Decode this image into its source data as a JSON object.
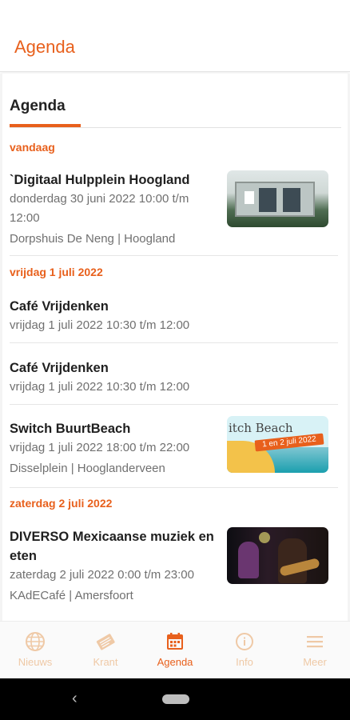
{
  "app": {
    "title": "Agenda"
  },
  "tabs": {
    "active": "Agenda"
  },
  "days": [
    {
      "label": "vandaag",
      "events": [
        {
          "title": "`Digitaal Hulpplein Hoogland",
          "lines": [
            "donderdag 30 juni 2022 10:00 t/m",
            "12:00"
          ],
          "place": "Dorpshuis De Neng | Hoogland",
          "image": "building-photo"
        }
      ]
    },
    {
      "label": "vrijdag 1 juli 2022",
      "events": [
        {
          "title": "Café Vrijdenken",
          "lines": [
            "vrijdag 1 juli 2022 10:30 t/m 12:00"
          ]
        },
        {
          "title": "Café Vrijdenken",
          "lines": [
            "vrijdag 1 juli 2022 10:30 t/m 12:00"
          ]
        },
        {
          "title": "Switch BuurtBeach",
          "lines": [
            "vrijdag 1 juli 2022 18:00 t/m 22:00"
          ],
          "place": "Disselplein | Hooglanderveen",
          "image": "beach-poster",
          "image_text": "itch Beach",
          "image_banner": "1 en 2 juli 2022"
        }
      ]
    },
    {
      "label": "zaterdag 2 juli 2022",
      "events": [
        {
          "title_line1": "DIVERSO Mexicaanse muziek en",
          "title_line2": "eten",
          "lines": [
            "zaterdag 2 juli 2022 0:00 t/m 23:00"
          ],
          "place": "KAdECafé | Amersfoort",
          "image": "musicians-photo"
        }
      ]
    }
  ],
  "bottom_nav": [
    {
      "label": "Nieuws",
      "icon": "globe-icon",
      "active": false
    },
    {
      "label": "Krant",
      "icon": "newspaper-icon",
      "active": false
    },
    {
      "label": "Agenda",
      "icon": "calendar-icon",
      "active": true
    },
    {
      "label": "Info",
      "icon": "info-icon",
      "active": false
    },
    {
      "label": "Meer",
      "icon": "menu-icon",
      "active": false
    }
  ],
  "colors": {
    "accent": "#e8601c",
    "inactive_nav": "#efc9a6",
    "muted_text": "#707070"
  }
}
